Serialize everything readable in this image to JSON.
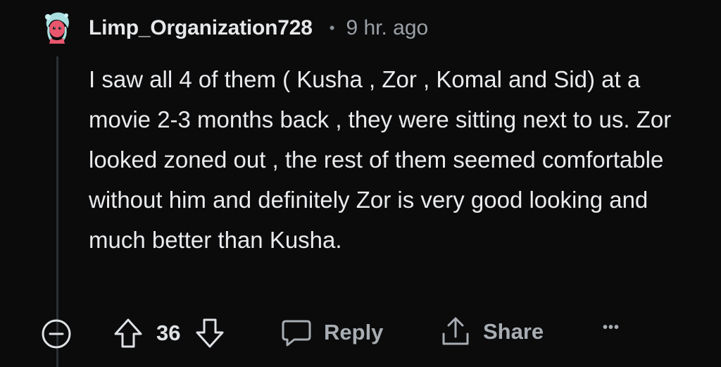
{
  "comment": {
    "author": "Limp_Organization728",
    "separator": "•",
    "timestamp": "9 hr. ago",
    "body": "I saw all 4 of them ( Kusha , Zor , Komal and Sid) at a movie 2-3 months back , they were sitting next to us. Zor looked zoned out , the rest of them seemed comfortable without him and definitely Zor is very good looking and much better than Kusha."
  },
  "actions": {
    "vote_count": "36",
    "reply_label": "Reply",
    "share_label": "Share",
    "more_label": "•••"
  },
  "icons": {
    "collapse": "minus-circle-icon",
    "upvote": "arrow-up-icon",
    "downvote": "arrow-down-icon",
    "reply": "speech-bubble-icon",
    "share": "share-icon",
    "more": "more-dots-icon"
  },
  "colors": {
    "background": "#0b0b0c",
    "text": "#e6e8ea",
    "muted": "#9aa0a6",
    "avatar_accent": "#e8576e",
    "avatar_hair": "#a9dfe0"
  }
}
